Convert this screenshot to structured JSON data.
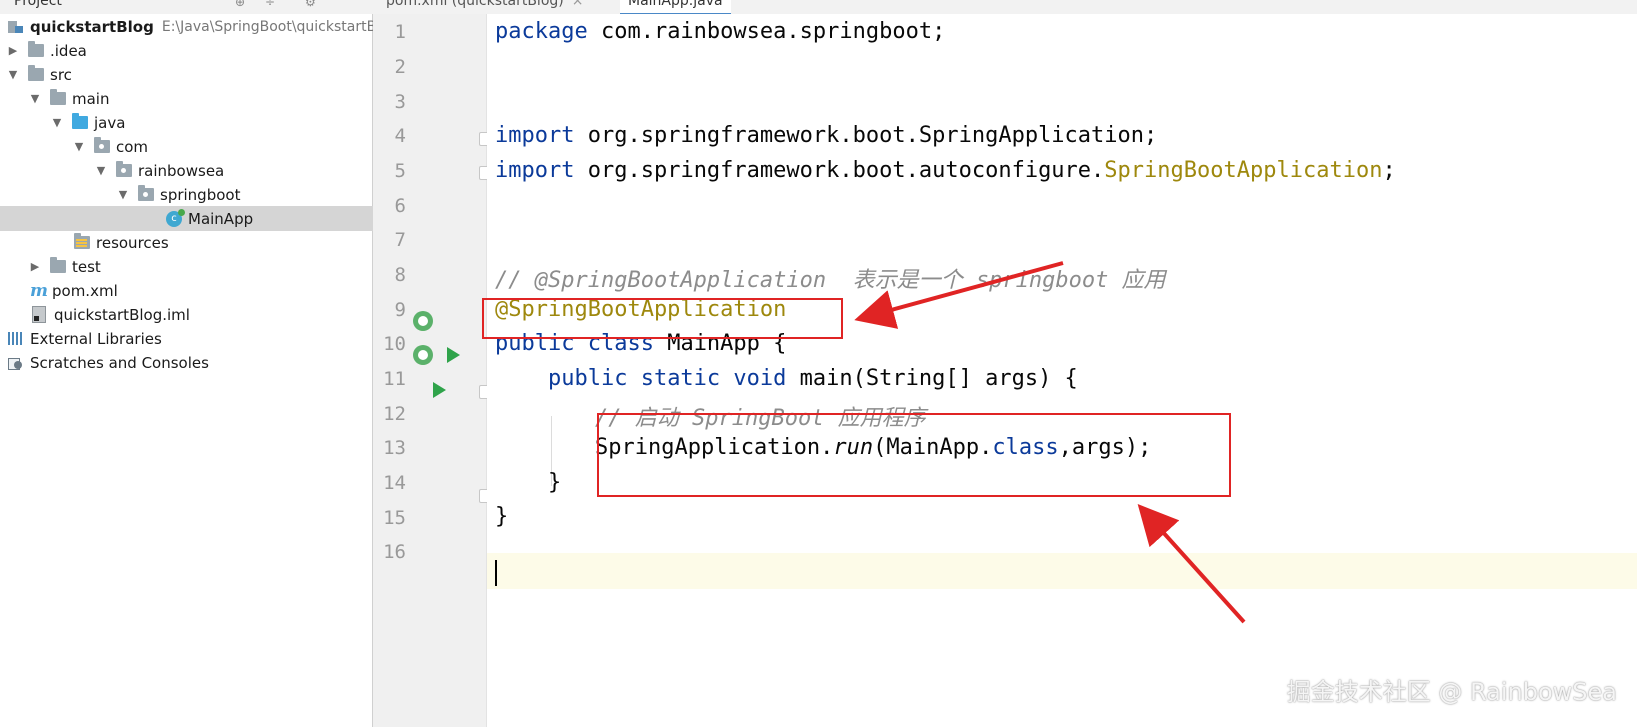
{
  "top_bar": {
    "project_label": "Project",
    "tab_pom": "pom.xml (quickstartBlog)",
    "tab_mainapp": "MainApp.java",
    "close_glyph": "×"
  },
  "project_tree": {
    "root_name": "quickstartBlog",
    "root_path": "E:\\Java\\SpringBoot\\quickstartB",
    "items": {
      "idea": ".idea",
      "src": "src",
      "main": "main",
      "java": "java",
      "com": "com",
      "rainbowsea": "rainbowsea",
      "springboot": "springboot",
      "mainapp": "MainApp",
      "resources": "resources",
      "test": "test",
      "pom": "pom.xml",
      "iml": "quickstartBlog.iml",
      "external_libraries": "External Libraries",
      "scratches": "Scratches and Consoles"
    }
  },
  "editor": {
    "line_numbers": [
      "1",
      "2",
      "3",
      "4",
      "5",
      "6",
      "7",
      "8",
      "9",
      "10",
      "11",
      "12",
      "13",
      "14",
      "15",
      "16"
    ],
    "code": {
      "l1_kw": "package",
      "l1_rest": " com.rainbowsea.springboot;",
      "l4_kw": "import",
      "l4_rest": " org.springframework.boot.SpringApplication;",
      "l5_kw": "import",
      "l5_rest": " org.springframework.boot.autoconfigure.",
      "l5_ann": "SpringBootApplication",
      "l5_end": ";",
      "l8_comment": "// @SpringBootApplication  表示是一个 springboot 应用",
      "l9_ann": "@SpringBootApplication",
      "l10_kw": "public class",
      "l10_rest": " MainApp {",
      "l11_indent": "    ",
      "l11_kw": "public static void",
      "l11_rest": " main(String[] args) {",
      "l12_comment": "// 启动 SpringBoot 应用程序",
      "l13_a": "SpringApplication.",
      "l13_run": "run",
      "l13_b": "(MainApp.",
      "l13_class": "class",
      "l13_c": ",args);",
      "l14": "    }",
      "l15": "}"
    }
  },
  "watermark": "掘金技术社区 @ RainbowSea",
  "colors": {
    "keyword": "#0b3a9a",
    "annotation": "#9e880d",
    "comment": "#8c8c8c",
    "highlight_red": "#e02424"
  }
}
